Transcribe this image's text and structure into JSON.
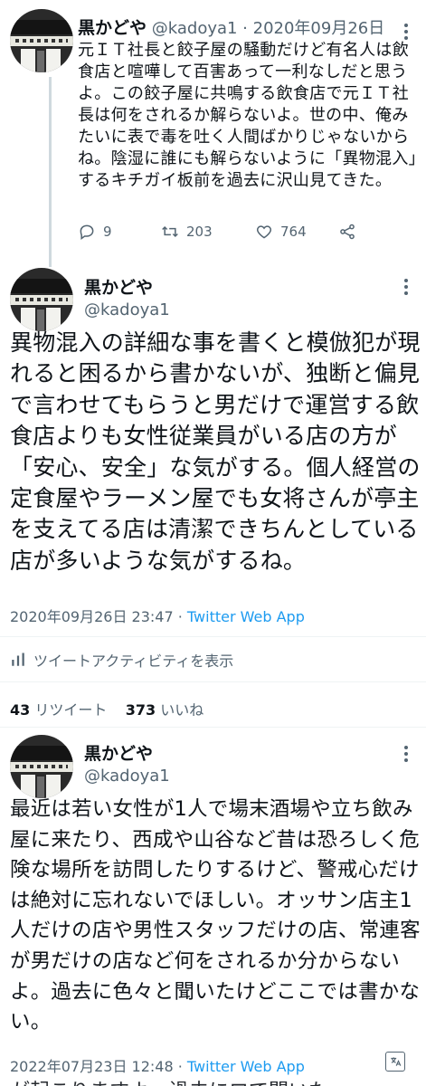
{
  "tweet1": {
    "display_name": "黒かどや",
    "handle_date": "@kadoya1 · 2020年09月26日",
    "body": "元ＩＴ社長と餃子屋の騒動だけど有名人は飲食店と喧嘩して百害あって一利なしだと思うよ。この餃子屋に共鳴する飲食店で元ＩＴ社長は何をされるか解らないよ。世の中、俺みたいに表で毒を吐く人間ばかりじゃないからね。陰湿に誰にも解らないように「異物混入」するキチガイ板前を過去に沢山見てきた。",
    "reply_count": "9",
    "retweet_count": "203",
    "like_count": "764",
    "icons": [
      "reply-icon",
      "retweet-icon",
      "heart-icon",
      "share-icon"
    ]
  },
  "tweet2": {
    "display_name": "黒かどや",
    "handle": "@kadoya1",
    "body": "異物混入の詳細な事を書くと模倣犯が現れると困るから書かないが、独断と偏見で言わせてもらうと男だけで運営する飲食店よりも女性従業員がいる店の方が「安心、安全」な気がする。個人経営の定食屋やラーメン屋でも女将さんが亭主を支えてる店は清潔できちんとしている店が多いような気がするね。",
    "timestamp": "2020年09月26日 23:47 · ",
    "source": "Twitter Web App",
    "activity_label": "ツイートアクティビティを表示",
    "retweets_num": "43",
    "retweets_label": " リツイート",
    "likes_num": "373",
    "likes_label": " いいね"
  },
  "tweet3": {
    "display_name": "黒かどや",
    "handle": "@kadoya1",
    "body": "最近は若い女性が1人で場末酒場や立ち飲み屋に来たり、西成や山谷など昔は恐ろしく危険な場所を訪問したりするけど、警戒心だけは絶対に忘れないでほしい。オッサン店主1人だけの店や男性スタッフだけの店、常連客が男だけの店など何をされるか分からないよ。過去に色々と聞いたけどここでは書かない。",
    "timestamp": "2022年07月23日 12:48 · ",
    "source": "Twitter Web App",
    "cutoff_text": "が起こりますよ。過去にロで聞いた"
  },
  "colors": {
    "text": "#0f1419",
    "secondary": "#536471",
    "link": "#1d9bf0",
    "divider": "#eff3f4"
  }
}
